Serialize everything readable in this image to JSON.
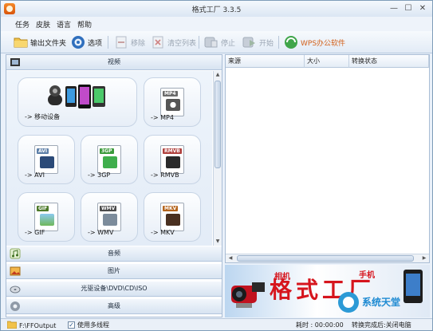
{
  "window": {
    "title": "格式工厂 3.3.5"
  },
  "menu": [
    "任务",
    "皮肤",
    "语言",
    "帮助"
  ],
  "toolbar": {
    "output_folder": "输出文件夹",
    "options": "选项",
    "remove": "移除",
    "clear_list": "清空列表",
    "stop": "停止",
    "start": "开始",
    "wps": "WPS办公软件"
  },
  "categories": {
    "video": "视频",
    "audio": "音频",
    "picture": "图片",
    "rom": "光驱设备\\DVD\\CD\\ISO",
    "advanced": "高级"
  },
  "video_tiles": [
    {
      "label": "-> 移动设备",
      "icon": "mobile-devices-icon"
    },
    {
      "label": "-> MP4",
      "icon": "mp4-file-icon",
      "tag": "MP4",
      "color": "#6b6b6b"
    },
    {
      "label": "-> AVI",
      "icon": "avi-file-icon",
      "tag": "AVI",
      "color": "#5c7fa8"
    },
    {
      "label": "-> 3GP",
      "icon": "3gp-file-icon",
      "tag": "3GP",
      "color": "#3a9a3a"
    },
    {
      "label": "-> RMVB",
      "icon": "rmvb-file-icon",
      "tag": "RMVB",
      "color": "#b0413e"
    },
    {
      "label": "-> GIF",
      "icon": "gif-file-icon",
      "tag": "GIF",
      "color": "#4d7a2a"
    },
    {
      "label": "-> WMV",
      "icon": "wmv-file-icon",
      "tag": "WMV",
      "color": "#4b4b4b"
    },
    {
      "label": "-> MKV",
      "icon": "mkv-file-icon",
      "tag": "MKV",
      "color": "#b5651d"
    }
  ],
  "columns": {
    "source": "来源",
    "size": "大小",
    "status": "转换状态"
  },
  "banner": {
    "text": "格式工厂",
    "small_left": "相机",
    "small_right": "手机",
    "watermark": "系统天堂"
  },
  "status": {
    "path": "F:\\FFOutput",
    "multithread_label": "使用多线程",
    "multithread_checked": "✓",
    "elapsed": "耗时 : 00:00:00",
    "after_done": "转换完成后:关闭电脑"
  }
}
